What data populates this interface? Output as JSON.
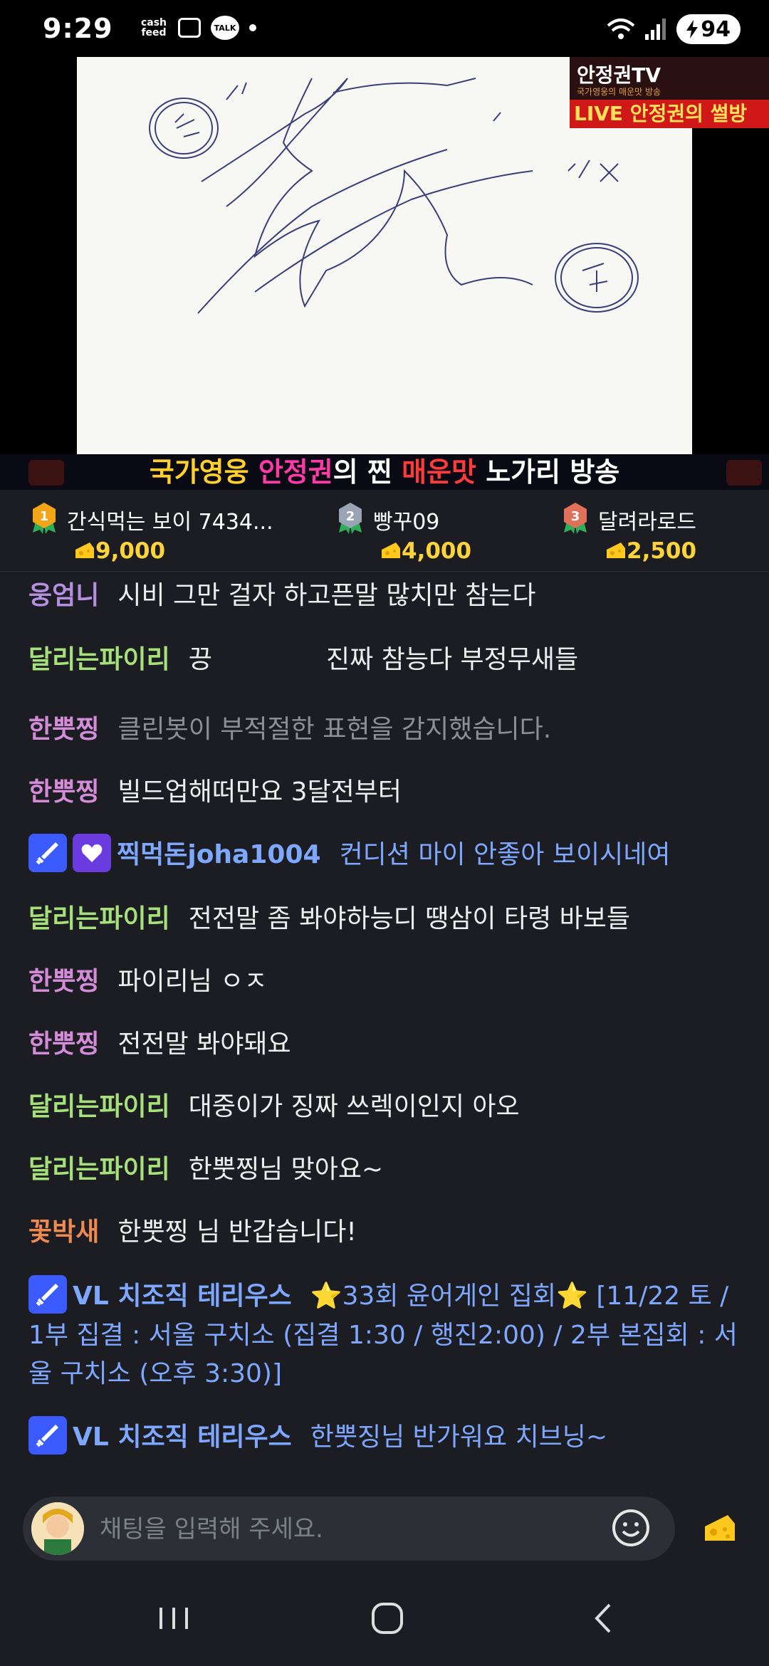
{
  "status_bar": {
    "time": "9:29",
    "cashfeed": "cash feed",
    "talk": "TALK",
    "battery": "94"
  },
  "video": {
    "channel_name": "안정권TV",
    "channel_sub": "국가영웅의 매운맛 방송",
    "live_label": "LIVE 안정권의 썰방",
    "banner": {
      "part1": "국가영웅 ",
      "part2": "안정권",
      "part3": "의 찐 ",
      "part4": "매운맛",
      "part5": " 노가리 방송"
    }
  },
  "ranking": [
    {
      "rank": "1",
      "name": "간식먹는 보이 7434...",
      "amount": "9,000",
      "color": "#f2a516"
    },
    {
      "rank": "2",
      "name": "빵꾸09",
      "amount": "4,000",
      "color": "#9aa4b4"
    },
    {
      "rank": "3",
      "name": "달려라로드",
      "amount": "2,500",
      "color": "#e0705a"
    }
  ],
  "chat": {
    "messages": [
      {
        "nick": "웅엄니",
        "text": "시비 그만 걸자 하고픈말 많치만 참는다"
      },
      {
        "nick": "달리는파이리",
        "text": "끙              진짜 참능다 부정무새들"
      },
      {
        "nick": "한뿟찡",
        "text": "클린봇이 부적절한 표현을 감지했습니다."
      },
      {
        "nick": "한뿟찡",
        "text": "빌드업해떠만요 3달전부터"
      },
      {
        "nick": "찍먹돈joha1004",
        "text": "컨디션 마이 안좋아 보이시네여"
      },
      {
        "nick": "달리는파이리",
        "text": "전전말 좀 봐야하능디 땡삼이 타령 바보들"
      },
      {
        "nick": "한뿟찡",
        "text": "파이리님 ㅇㅈ"
      },
      {
        "nick": "한뿟찡",
        "text": "전전말 봐야돼요"
      },
      {
        "nick": "달리는파이리",
        "text": "대중이가 징짜 쓰렉이인지 아오"
      },
      {
        "nick": "달리는파이리",
        "text": "한뿟찡님 맞아요~"
      },
      {
        "nick": "꽃박새",
        "text": "한뿟찡 님 반갑습니다!"
      },
      {
        "nick": "VL 치조직 테리우스",
        "text": "⭐33회 윤어게인 집회⭐ [11/22 토 / 1부 집결 : 서울 구치소 (집결 1:30 / 행진2:00) / 2부 본집회 : 서울 구치소 (오후 3:30)]"
      },
      {
        "nick": "VL 치조직 테리우스",
        "text": "한뿟징님 반가워요 치브닝~"
      }
    ]
  },
  "input": {
    "placeholder": "채팅을 입력해 주세요."
  }
}
